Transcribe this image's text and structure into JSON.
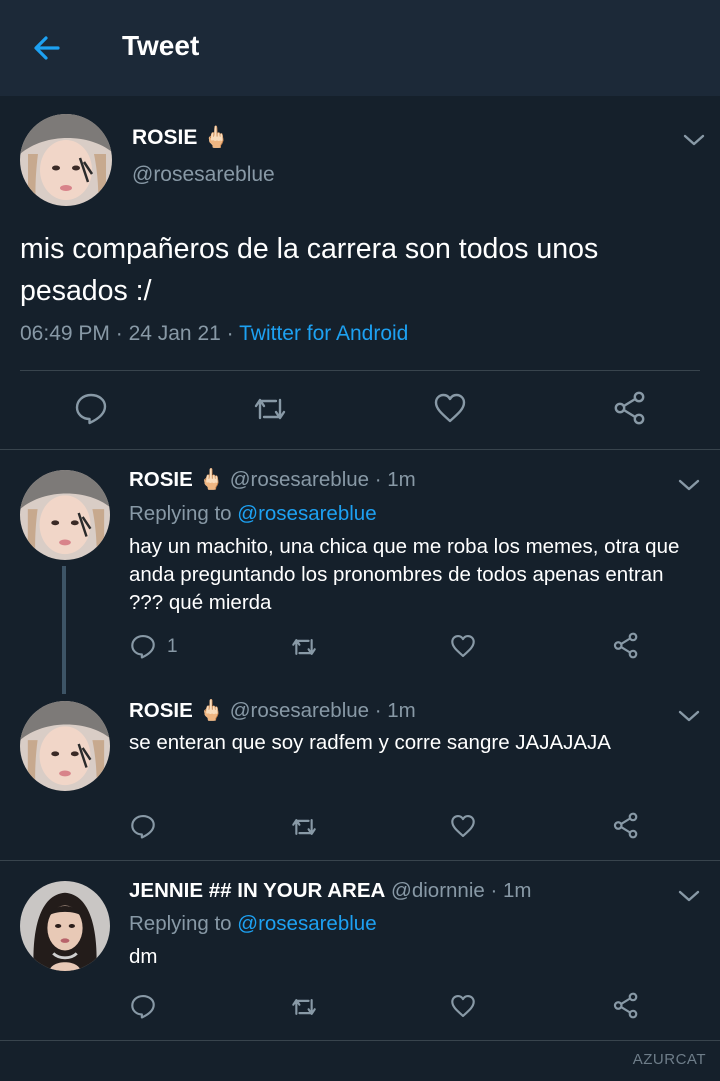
{
  "header": {
    "title": "Tweet"
  },
  "main_tweet": {
    "name": "ROSIE 🖕🏻",
    "handle": "@rosesareblue",
    "text": "mis compañeros de la carrera son todos unos pesados :/",
    "time": "06:49 PM",
    "date": "24 Jan 21",
    "source": "Twitter for Android"
  },
  "replies": [
    {
      "name": "ROSIE 🖕🏻",
      "handle_time": "@rosesareblue · 1m",
      "replying_prefix": "Replying to",
      "replying_to": "@rosesareblue",
      "text": "hay un machito, una chica que me roba los memes, otra que anda preguntando los pronombres de todos apenas entran ??? qué mierda",
      "reply_count": "1"
    },
    {
      "name": "ROSIE 🖕🏻",
      "handle_time": "@rosesareblue · 1m",
      "text": "se enteran que soy radfem y corre sangre JAJAJAJA"
    },
    {
      "name": "JENNIE ## IN YOUR AREA",
      "handle_time": "@diornnie · 1m",
      "replying_prefix": "Replying to",
      "replying_to": "@rosesareblue",
      "text": "dm"
    }
  ],
  "watermark": "AZURCAT",
  "colors": {
    "background": "#15202b",
    "header": "#1c2938",
    "accent": "#1da1f2",
    "muted": "#8899a6",
    "divider": "#38444d"
  },
  "icons": [
    "back-arrow-icon",
    "chevron-down-icon",
    "reply-icon",
    "retweet-icon",
    "like-icon",
    "share-icon"
  ]
}
